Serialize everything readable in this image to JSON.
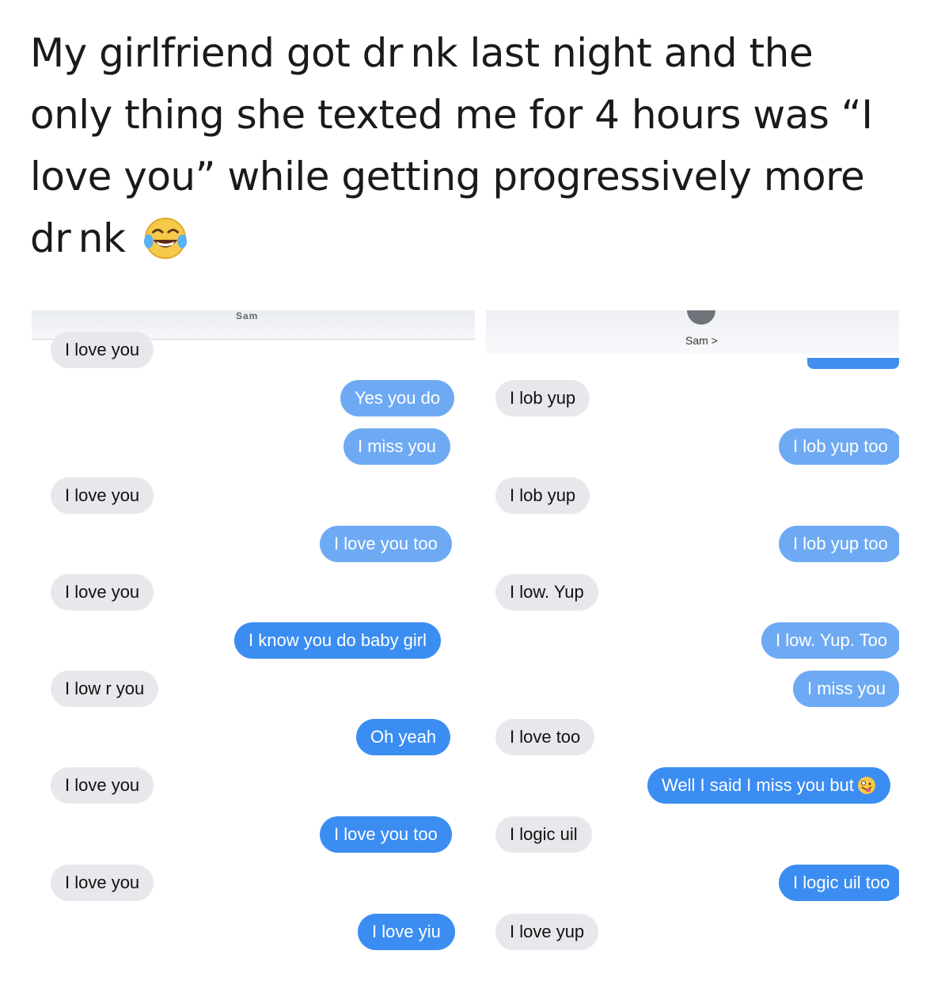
{
  "post": {
    "caption_line1": "My girlfriend got dr nk last night and the",
    "caption_line2": "only thing she texted me for 4 hours was “I",
    "caption_line3": "love you” while getting progressively more",
    "caption_line4": "dr nk",
    "caption_emoji": "tears-of-joy-emoji"
  },
  "left_screenshot": {
    "contact_name": "Sam",
    "messages": [
      {
        "text": "I love you",
        "type": "received"
      },
      {
        "text": "Yes you do",
        "type": "sent"
      },
      {
        "text": "I miss you",
        "type": "sent"
      },
      {
        "text": "I love you",
        "type": "received"
      },
      {
        "text": "I love you too",
        "type": "sent"
      },
      {
        "text": "I love you",
        "type": "received"
      },
      {
        "text": "I know you do baby girl",
        "type": "sent"
      },
      {
        "text": "I low r you",
        "type": "received"
      },
      {
        "text": "Oh yeah",
        "type": "sent"
      },
      {
        "text": "I love you",
        "type": "received"
      },
      {
        "text": "I love you too",
        "type": "sent"
      },
      {
        "text": "I love you",
        "type": "received"
      },
      {
        "text": "I love yiu",
        "type": "sent"
      }
    ]
  },
  "right_screenshot": {
    "contact_name": "Sam >",
    "messages": [
      {
        "text": "I lob yup",
        "type": "received"
      },
      {
        "text": "I lob yup too",
        "type": "sent"
      },
      {
        "text": "I lob yup",
        "type": "received"
      },
      {
        "text": "I lob yup too",
        "type": "sent"
      },
      {
        "text": "I low. Yup",
        "type": "received"
      },
      {
        "text": "I low. Yup. Too",
        "type": "sent"
      },
      {
        "text": "I miss you",
        "type": "sent"
      },
      {
        "text": "I love too",
        "type": "received"
      },
      {
        "text": "Well I said I miss you but",
        "type": "sent",
        "emoji": "zany-face-emoji"
      },
      {
        "text": "I logic uil",
        "type": "received"
      },
      {
        "text": "I logic uil too",
        "type": "sent"
      },
      {
        "text": "I love yup",
        "type": "received"
      }
    ]
  },
  "colors": {
    "sent_bubble": "#3b8df2",
    "received_bubble": "#e8e8ec",
    "caption_text": "#1a1a1a"
  }
}
